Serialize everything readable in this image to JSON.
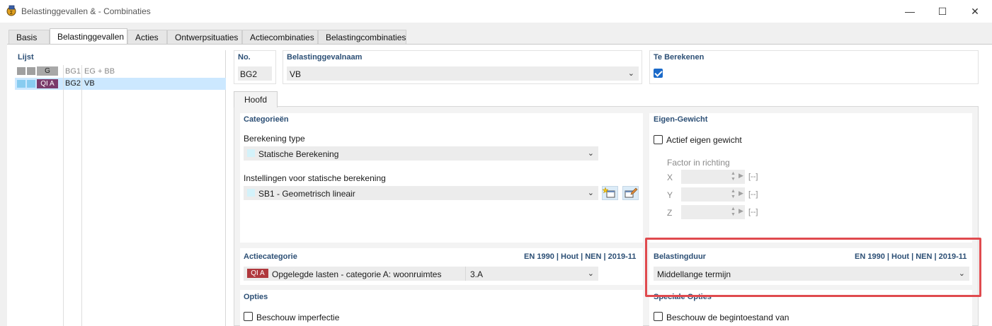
{
  "window": {
    "title": "Belastinggevallen & - Combinaties",
    "minimize": "—",
    "maximize": "☐",
    "close": "✕"
  },
  "tabs": [
    {
      "label": "Basis",
      "active": false
    },
    {
      "label": "Belastinggevallen",
      "active": true
    },
    {
      "label": "Acties",
      "active": false
    },
    {
      "label": "Ontwerpsituaties",
      "active": false
    },
    {
      "label": "Actiecombinaties",
      "active": false
    },
    {
      "label": "Belastingcombinaties",
      "active": false
    }
  ],
  "list": {
    "header": "Lijst",
    "rows": [
      {
        "badge": "G",
        "no": "BG1",
        "name": "EG + BB",
        "selected": false
      },
      {
        "badge": "QI A",
        "no": "BG2",
        "name": "VB",
        "selected": true
      }
    ]
  },
  "header_fields": {
    "no_label": "No.",
    "no_value": "BG2",
    "name_label": "Belastinggevalnaam",
    "name_value": "VB",
    "calc_label": "Te Berekenen",
    "calc_checked": true
  },
  "inner_tab": "Hoofd",
  "categories": {
    "header": "Categorieën",
    "calc_type_label": "Berekening type",
    "calc_type_value": "Statische Berekening",
    "settings_label": "Instellingen voor statische berekening",
    "settings_value": "SB1 - Geometrisch lineair"
  },
  "self_weight": {
    "header": "Eigen-Gewicht",
    "active_label": "Actief eigen gewicht",
    "active_checked": false,
    "factor_label": "Factor in richting",
    "axes": [
      {
        "axis": "X",
        "unit": "[--]"
      },
      {
        "axis": "Y",
        "unit": "[--]"
      },
      {
        "axis": "Z",
        "unit": "[--]"
      }
    ]
  },
  "action_category": {
    "header": "Actiecategorie",
    "norm": "EN 1990 | Hout | NEN | 2019-11",
    "badge": "QI A",
    "value": "Opgelegde lasten - categorie A: woonruimtes",
    "code": "3.A"
  },
  "load_duration": {
    "header": "Belastingduur",
    "norm": "EN 1990 | Hout | NEN | 2019-11",
    "value": "Middellange termijn"
  },
  "options": {
    "header": "Opties",
    "imperfection_label": "Beschouw imperfectie"
  },
  "special_options": {
    "header": "Speciale Opties",
    "initial_state_label": "Beschouw de begintoestand van"
  },
  "colors": {
    "accent_blue": "#1b6ac9",
    "section_header": "#2c4f75",
    "qi_badge": "#b0383d",
    "highlight_red": "#e04a4e",
    "selection": "#cce8ff"
  }
}
